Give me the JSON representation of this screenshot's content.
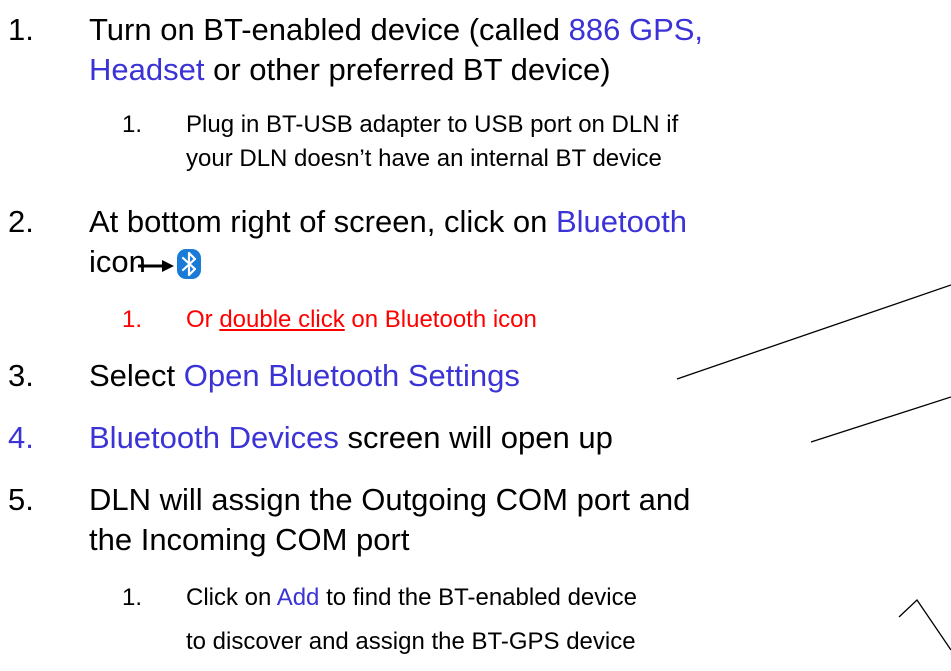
{
  "items": [
    {
      "number": "1.",
      "line1": {
        "pre": "Turn on BT-enabled device (called ",
        "highlight": "886 GPS,"
      },
      "line2": {
        "highlight": "Headset",
        "post": " or other preferred BT device)"
      },
      "sub": [
        {
          "number": "1.",
          "line1": "Plug in BT-USB adapter to USB port on DLN if",
          "line2": "your DLN doesn’t have an internal BT device"
        }
      ]
    },
    {
      "number": "2.",
      "line1": {
        "pre": "At bottom right of screen, click on ",
        "highlight": "Bluetooth"
      },
      "line2": {
        "pre": "icon"
      },
      "sub": [
        {
          "number": "1.",
          "pre": "Or ",
          "underlined": "double click",
          "post": " on Bluetooth icon"
        }
      ]
    },
    {
      "number": "3.",
      "pre": "Select ",
      "highlight": "Open Bluetooth Settings"
    },
    {
      "number": "4.",
      "highlight": "Bluetooth Devices",
      "post": " screen will open up"
    },
    {
      "number": "5.",
      "line1": "DLN will assign the Outgoing COM port and",
      "line2": "the Incoming COM port",
      "sub": [
        {
          "number": "1.",
          "pre": "Click on ",
          "highlight": "Add",
          "post": " to find the BT-enabled device",
          "line2": "to discover and assign the BT-GPS device"
        }
      ]
    }
  ],
  "icons": {
    "bluetooth": "bluetooth-icon",
    "arrow": "right-arrow-icon"
  },
  "colors": {
    "highlight": "#3b33d6",
    "alert": "#ff0000",
    "bluetooth_bg": "#1a7bd6"
  }
}
